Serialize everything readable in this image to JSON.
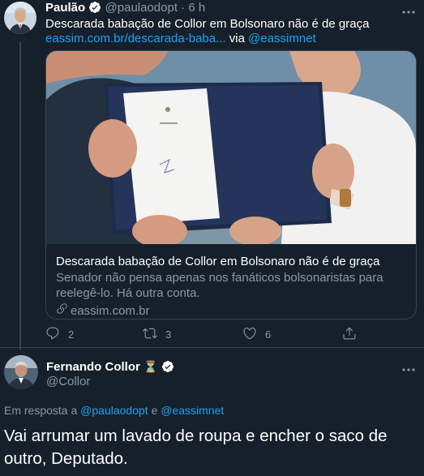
{
  "tweet1": {
    "author_name": "Paulão",
    "handle": "@paulaodopt",
    "separator": "·",
    "time": "6 h",
    "text": "Descarada babação de Collor em Bolsonaro não é de graça",
    "link_text": "eassim.com.br/descarada-baba...",
    "via_text": "via",
    "via_handle": "@eassimnet",
    "card": {
      "title": "Descarada babação de Collor em Bolsonaro não é de graça",
      "description": "Senador não pensa apenas nos fanáticos bolsonaristas para reelegê-lo. Há outra conta.",
      "domain": "eassim.com.br"
    },
    "actions": {
      "reply_count": "2",
      "retweet_count": "3",
      "like_count": "6"
    }
  },
  "tweet2": {
    "author_name": "Fernando Collor",
    "emoji": "⏳",
    "handle": "@Collor",
    "reply_prefix": "Em resposta a",
    "reply_user1": "@paulaodopt",
    "reply_and": "e",
    "reply_user2": "@eassimnet",
    "text": "Vai arrumar um lavado de roupa e encher o saco de outro,  Deputado."
  },
  "colors": {
    "background": "#15202b",
    "border": "#38444d",
    "muted": "#8899a6",
    "link": "#1da1f2",
    "text": "#ffffff"
  },
  "icons": [
    "verified-badge-icon",
    "more-options-icon",
    "link-icon",
    "reply-icon",
    "retweet-icon",
    "like-icon",
    "share-icon",
    "hourglass-icon"
  ]
}
